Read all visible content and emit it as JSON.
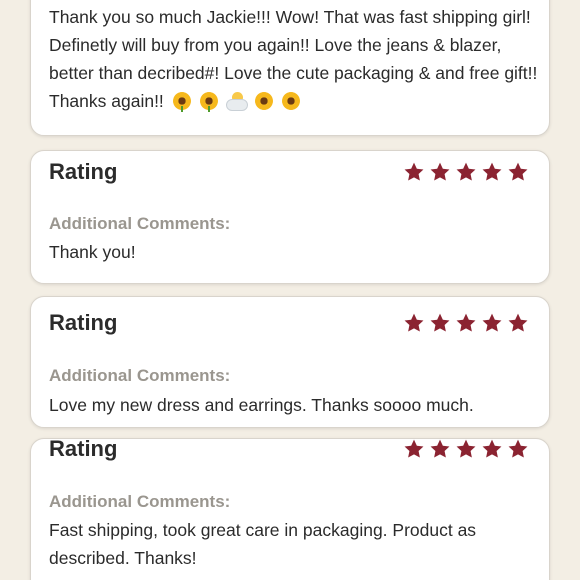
{
  "review_1": {
    "text": "Thank you so much Jackie!!! Wow! That was fast shipping girl! Definetly will buy from you again!! Love the jeans & blazer, better than decribed#! Love the cute packaging & and free gift!! Thanks again!!",
    "emojis": [
      "sunflower-icon",
      "sunflower-icon",
      "sun-behind-cloud-icon",
      "blossom-icon",
      "blossom-icon"
    ]
  },
  "reviews": [
    {
      "rating_label": "Rating",
      "stars": 5,
      "comments_label": "Additional Comments:",
      "comment": "Thank you!"
    },
    {
      "rating_label": "Rating",
      "stars": 5,
      "comments_label": "Additional Comments:",
      "comment": "Love my new dress and earrings. Thanks soooo much."
    },
    {
      "rating_label": "Rating",
      "stars": 5,
      "comments_label": "Additional Comments:",
      "comment": "Fast shipping, took great care in packaging. Product as described. Thanks!"
    }
  ],
  "colors": {
    "star": "#8b2331",
    "background": "#f3eee4",
    "label_gray": "#9a968f"
  }
}
